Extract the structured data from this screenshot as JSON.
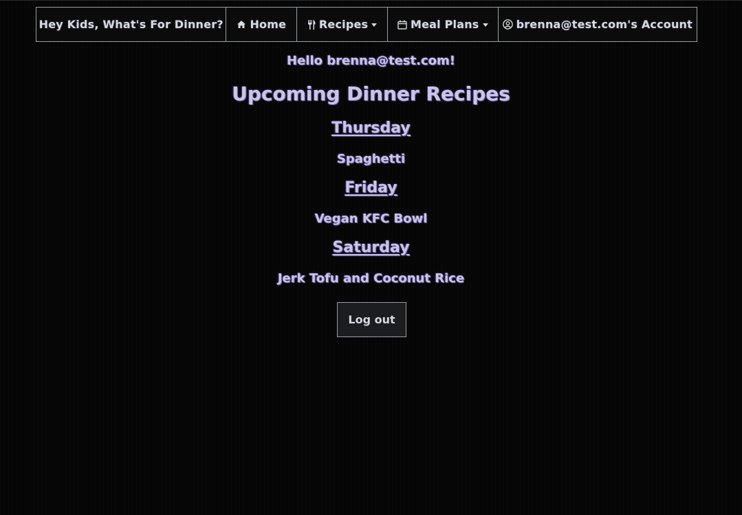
{
  "nav": {
    "brand": "Hey Kids, What's For Dinner?",
    "home": "Home",
    "recipes": "Recipes",
    "meal_plans": "Meal Plans",
    "account": "brenna@test.com's Account"
  },
  "main": {
    "greeting": "Hello brenna@test.com!",
    "title": "Upcoming Dinner Recipes",
    "days": [
      {
        "day": "Thursday",
        "recipe": "Spaghetti"
      },
      {
        "day": "Friday",
        "recipe": "Vegan KFC Bowl"
      },
      {
        "day": "Saturday",
        "recipe": "Jerk Tofu and Coconut Rice"
      }
    ],
    "logout_label": "Log out"
  },
  "icons": {
    "home": "home-icon",
    "recipes": "utensils-icon",
    "meal_plans": "calendar-icon",
    "account": "user-circle-icon"
  },
  "colors": {
    "background": "#060606",
    "text": "#c9c6e6",
    "nav_text": "#d6d9e0",
    "border": "#9aa0a6"
  }
}
